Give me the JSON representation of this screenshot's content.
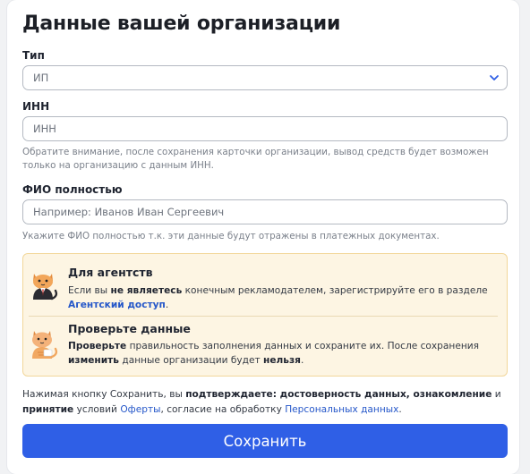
{
  "form": {
    "title": "Данные вашей организации",
    "type": {
      "label": "Тип",
      "value": "ИП"
    },
    "inn": {
      "label": "ИНН",
      "placeholder": "ИНН",
      "hint": "Обратите внимание, после сохранения карточки организации, вывод средств будет возможен только на организацию с данным ИНН."
    },
    "fio": {
      "label": "ФИО полностью",
      "placeholder": "Например: Иванов Иван Сергеевич",
      "hint": "Укажите ФИО полностью т.к. эти данные будут отражены в платежных документах."
    }
  },
  "notice": {
    "agents": {
      "title": "Для агентств",
      "text_1": "Если вы ",
      "text_bold": "не являетесь",
      "text_2": " конечным рекламодателем, зарегистрируйте его в разделе ",
      "link": "Агентский доступ",
      "text_3": "."
    },
    "check": {
      "title": "Проверьте данные",
      "bold_1": "Проверьте",
      "text_1": " правильность заполнения данных и сохраните их. После сохранения ",
      "bold_2": "изменить",
      "text_2": " данные организации будет ",
      "bold_3": "нельзя",
      "text_3": "."
    }
  },
  "consent": {
    "t1": "Нажимая кнопку Сохранить, вы ",
    "b1": "подтверждаете: достоверность данных, ознакомление",
    "t2": " и ",
    "b2": "принятие",
    "t3": " условий ",
    "link1": "Оферты",
    "t4": ", согласие на обработку ",
    "link2": "Персональных данных",
    "t5": "."
  },
  "save_button": "Сохранить",
  "icons": {
    "select": "chevron-down-icon",
    "agent": "cat-in-suit-icon",
    "check": "ginger-cat-icon"
  },
  "colors": {
    "accent": "#2f5fe6",
    "link": "#2557c9",
    "notice_bg": "#fdf5e3",
    "notice_border": "#f2d79a"
  }
}
